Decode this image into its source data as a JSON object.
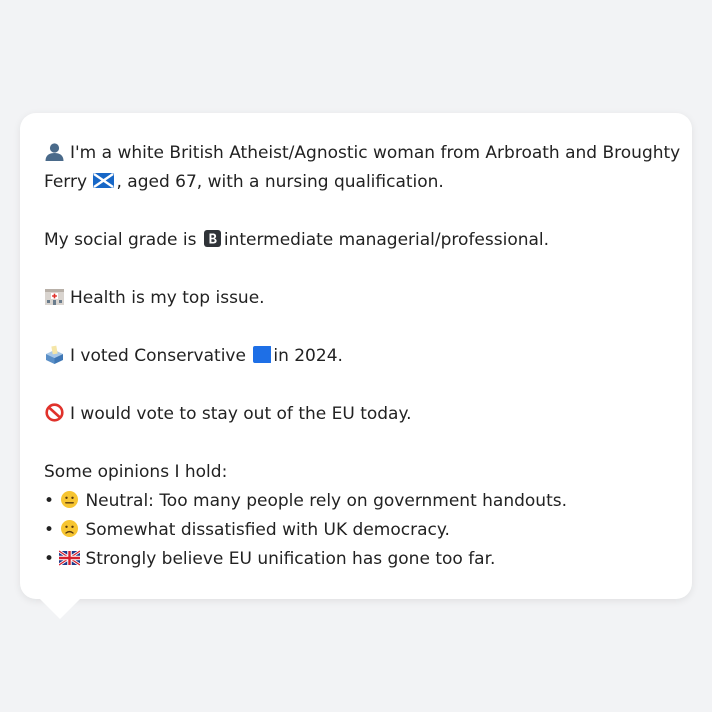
{
  "profile": {
    "intro_line1": "I'm a white British Atheist/Agnostic woman from Arbroath and Broughty",
    "intro_line2_a": "Ferry",
    "intro_line2_b": ", aged 67, with a nursing qualification.",
    "grade_a": "My social grade is",
    "grade_b": "intermediate managerial/professional.",
    "issue": "Health is my top issue.",
    "vote_a": "I voted Conservative",
    "vote_b": "in 2024.",
    "eu": "I would vote to stay out of the EU today.",
    "opinions_header": "Some opinions I hold:",
    "opinions": [
      {
        "bullet": "•",
        "text": "Neutral: Too many people rely on government handouts."
      },
      {
        "bullet": "•",
        "text": "Somewhat dissatisfied with UK democracy."
      },
      {
        "bullet": "•",
        "text": "Strongly believe EU unification has gone too far."
      }
    ]
  },
  "icons": {
    "person": "bust-in-silhouette-icon",
    "flag_scotland": "scotland-flag-icon",
    "grade_b": "b-button-icon",
    "health": "hospital-icon",
    "ballot": "ballot-box-icon",
    "conservative": "blue-square-icon",
    "eu_no": "prohibited-icon",
    "neutral": "neutral-face-icon",
    "dissatisfied": "slightly-frowning-face-icon",
    "uk_flag": "uk-flag-icon"
  },
  "colors": {
    "background": "#f2f3f5",
    "bubble": "#ffffff",
    "text": "#222222",
    "conservative_blue": "#1e6fe6",
    "prohibited_red": "#e0322b"
  }
}
